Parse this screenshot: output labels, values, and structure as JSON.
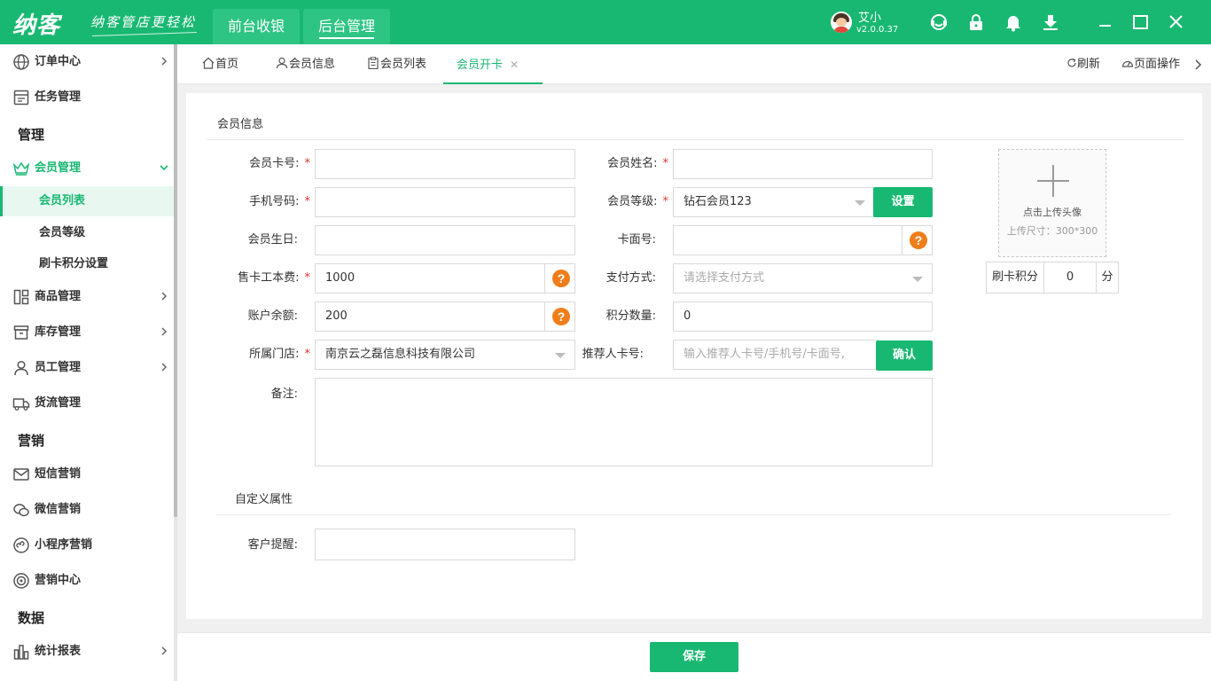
{
  "header": {
    "logo": "纳客",
    "slogan": "纳客管店更轻松",
    "tabs": [
      {
        "label": "前台收银"
      },
      {
        "label": "后台管理"
      }
    ],
    "user": {
      "name": "艾小",
      "version": "v2.0.0.37"
    },
    "icons": [
      "support-icon",
      "lock-icon",
      "bell-icon",
      "download-icon"
    ]
  },
  "sidebar": {
    "items": [
      {
        "label": "订单中心",
        "icon": "globe-icon"
      },
      {
        "label": "任务管理",
        "icon": "task-icon"
      },
      {
        "section": "管理"
      },
      {
        "label": "会员管理",
        "icon": "crown-icon",
        "expanded": true
      },
      {
        "sub": "会员列表",
        "active": true
      },
      {
        "sub": "会员等级"
      },
      {
        "sub": "刷卡积分设置"
      },
      {
        "label": "商品管理",
        "icon": "goods-icon"
      },
      {
        "label": "库存管理",
        "icon": "inventory-icon"
      },
      {
        "label": "员工管理",
        "icon": "person-icon"
      },
      {
        "label": "货流管理",
        "icon": "truck-icon"
      },
      {
        "section": "营销"
      },
      {
        "label": "短信营销",
        "icon": "mail-icon"
      },
      {
        "label": "微信营销",
        "icon": "wechat-icon"
      },
      {
        "label": "小程序营销",
        "icon": "miniapp-icon"
      },
      {
        "label": "营销中心",
        "icon": "target-icon"
      },
      {
        "section": "数据"
      },
      {
        "label": "统计报表",
        "icon": "chart-icon"
      }
    ],
    "labels": {
      "order": "订单中心",
      "task": "任务管理",
      "sec_manage": "管理",
      "member": "会员管理",
      "member_list": "会员列表",
      "member_level": "会员等级",
      "swipe_points": "刷卡积分设置",
      "goods": "商品管理",
      "inventory": "库存管理",
      "staff": "员工管理",
      "logistics": "货流管理",
      "sec_marketing": "营销",
      "sms": "短信营销",
      "wechat": "微信营销",
      "miniapp": "小程序营销",
      "mkt_center": "营销中心",
      "sec_data": "数据",
      "report": "统计报表"
    }
  },
  "page_tabs": {
    "home": "首页",
    "member_info": "会员信息",
    "member_list": "会员列表",
    "open_card": "会员开卡",
    "refresh": "刷新",
    "page_ops": "页面操作"
  },
  "form": {
    "section_title": "会员信息",
    "card_no_label": "会员卡号:",
    "card_no_value": "",
    "name_label": "会员姓名:",
    "name_value": "",
    "phone_label": "手机号码:",
    "phone_value": "",
    "level_label": "会员等级:",
    "level_value": "钻石会员123",
    "level_btn": "设置",
    "birthday_label": "会员生日:",
    "birthday_value": "",
    "card_face_label": "卡面号:",
    "card_face_value": "",
    "card_fee_label": "售卡工本费:",
    "card_fee_value": "1000",
    "payment_label": "支付方式:",
    "payment_placeholder": "请选择支付方式",
    "balance_label": "账户余额:",
    "balance_value": "200",
    "points_label": "积分数量:",
    "points_value": "0",
    "store_label": "所属门店:",
    "store_value": "南京云之磊信息科技有限公司",
    "referrer_label": "推荐人卡号:",
    "referrer_placeholder": "输入推荐人卡号/手机号/卡面号,",
    "referrer_btn": "确认",
    "remark_label": "备注:",
    "upload_text": "点击上传头像",
    "upload_size": "上传尺寸：300*300",
    "swipe_points_label": "刷卡积分",
    "swipe_points_value": "0",
    "swipe_points_unit": "分",
    "custom_title": "自定义属性",
    "reminder_label": "客户提醒:",
    "reminder_value": ""
  },
  "footer": {
    "save": "保存"
  },
  "colors": {
    "brand": "#19b872",
    "required": "#e0332d",
    "help": "#f07d1a"
  }
}
